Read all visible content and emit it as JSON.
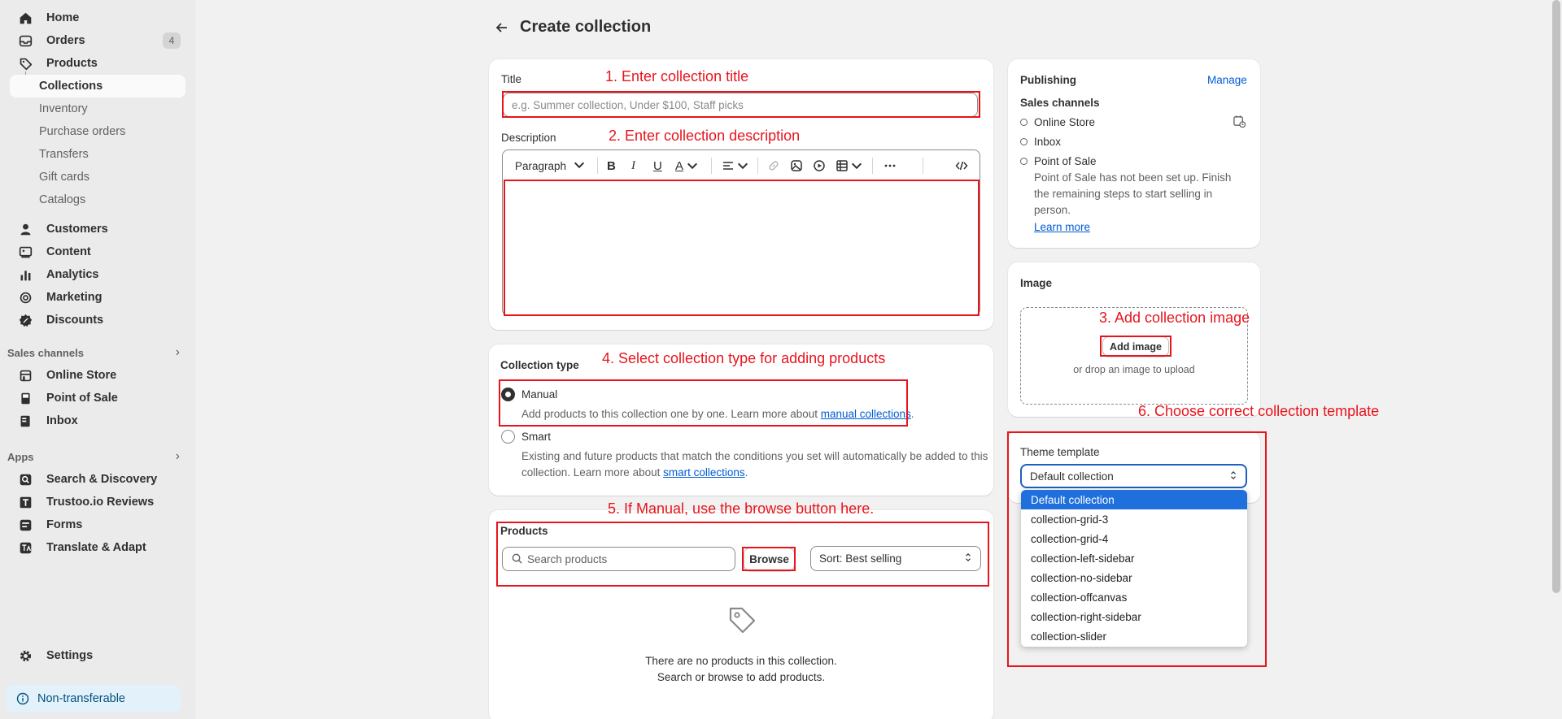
{
  "sidebar": {
    "items": [
      {
        "label": "Home",
        "icon": "home-icon"
      },
      {
        "label": "Orders",
        "icon": "inbox-tray-icon",
        "badge": "4"
      },
      {
        "label": "Products",
        "icon": "tag-icon"
      }
    ],
    "product_sub": [
      "Collections",
      "Inventory",
      "Purchase orders",
      "Transfers",
      "Gift cards",
      "Catalogs"
    ],
    "main_items": [
      {
        "label": "Customers",
        "icon": "person-icon"
      },
      {
        "label": "Content",
        "icon": "image-content-icon"
      },
      {
        "label": "Analytics",
        "icon": "bar-chart-icon"
      },
      {
        "label": "Marketing",
        "icon": "target-icon"
      },
      {
        "label": "Discounts",
        "icon": "discount-badge-icon"
      }
    ],
    "sales_channels_header": "Sales channels",
    "sales_channels": [
      {
        "label": "Online Store",
        "icon": "store-icon"
      },
      {
        "label": "Point of Sale",
        "icon": "pos-icon"
      },
      {
        "label": "Inbox",
        "icon": "inbox-app-icon"
      }
    ],
    "apps_header": "Apps",
    "apps": [
      {
        "label": "Search & Discovery",
        "icon": "search-app-icon"
      },
      {
        "label": "Trustoo.io Reviews",
        "icon": "trustoo-icon"
      },
      {
        "label": "Forms",
        "icon": "forms-icon"
      },
      {
        "label": "Translate & Adapt",
        "icon": "translate-icon"
      }
    ],
    "settings": "Settings",
    "non_transferable": "Non-transferable"
  },
  "page": {
    "title": "Create collection"
  },
  "title_card": {
    "title_label": "Title",
    "title_placeholder": "e.g. Summer collection, Under $100, Staff picks",
    "description_label": "Description",
    "toolbar_paragraph": "Paragraph"
  },
  "collection_type": {
    "label": "Collection type",
    "manual_label": "Manual",
    "manual_desc": "Add products to this collection one by one. Learn more about ",
    "manual_link": "manual collections",
    "smart_label": "Smart",
    "smart_desc_1": "Existing and future products that match the conditions you set will automatically be added to this",
    "smart_desc_2": "collection. Learn more about ",
    "smart_link": "smart collections",
    "selected": "Manual"
  },
  "products": {
    "label": "Products",
    "search_placeholder": "Search products",
    "browse": "Browse",
    "sort": "Sort: Best selling",
    "empty_1": "There are no products in this collection.",
    "empty_2": "Search or browse to add products."
  },
  "publishing": {
    "label": "Publishing",
    "manage": "Manage",
    "sales_channels": "Sales channels",
    "channels": [
      "Online Store",
      "Inbox",
      "Point of Sale"
    ],
    "pos_note_1": "Point of Sale has not been set up. Finish",
    "pos_note_2": "the remaining steps to start selling in",
    "pos_note_3": "person.",
    "learn_more": "Learn more"
  },
  "image_card": {
    "label": "Image",
    "add_image": "Add image",
    "drop_text": "or drop an image to upload"
  },
  "theme": {
    "label": "Theme template",
    "selected": "Default collection",
    "options": [
      "Default collection",
      "collection-grid-3",
      "collection-grid-4",
      "collection-left-sidebar",
      "collection-no-sidebar",
      "collection-offcanvas",
      "collection-right-sidebar",
      "collection-slider"
    ]
  },
  "annotations": {
    "a1": "1. Enter collection title",
    "a2": "2. Enter collection description",
    "a3": "3. Add collection image",
    "a4": "4. Select collection type for adding products",
    "a5": "5. If Manual, use the browse button here.",
    "a6": "6. Choose correct collection template"
  },
  "colors": {
    "annotation_red": "#e8141c",
    "link_blue": "#005bd3",
    "select_blue": "#1f6fdd"
  }
}
